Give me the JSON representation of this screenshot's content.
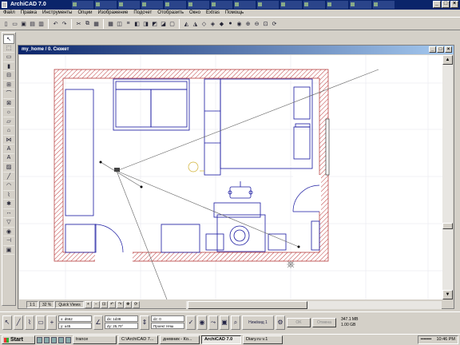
{
  "app": {
    "title": "ArchiCAD 7.0"
  },
  "title_tabs": [
    "",
    "",
    "",
    "",
    "",
    "",
    "",
    "",
    "",
    "",
    "",
    "",
    "",
    "",
    ""
  ],
  "menu": [
    "Файл",
    "Правка",
    "Инструменты",
    "Опции",
    "Изображение",
    "Подсчет",
    "Отобразить",
    "Окно",
    "Extras",
    "Помощь"
  ],
  "document": {
    "title": "my_home / 0. Сюжет"
  },
  "status": {
    "scale": "1:1",
    "zoom": "32 %",
    "quickviews": "Quick Views"
  },
  "info": {
    "x1": "x: d662",
    "y1": "y: u45",
    "x2": "dx: 1d38",
    "y2": "dy: 25,70°",
    "z": "dz: 0",
    "layer": "Проект Няш",
    "plan_label": "Ниж/вид 1",
    "ok_button": "OK",
    "cancel_button": "Отмена",
    "mem": "347.1 MB",
    "mem2": "1.00 GB"
  },
  "taskbar": {
    "start": "Start",
    "tasks": [
      "trance",
      "C:\\ArchiCAD 7...",
      "дневник - Ко...",
      "ArchiCAD 7.0",
      "Diary.ru v.1"
    ],
    "active": "ArchiCAD 7.0",
    "clock": "10:46 PM"
  },
  "colors": {
    "wall_hatch": "#c04040",
    "furniture": "#1818a0",
    "titlebar": "#0a246a"
  }
}
